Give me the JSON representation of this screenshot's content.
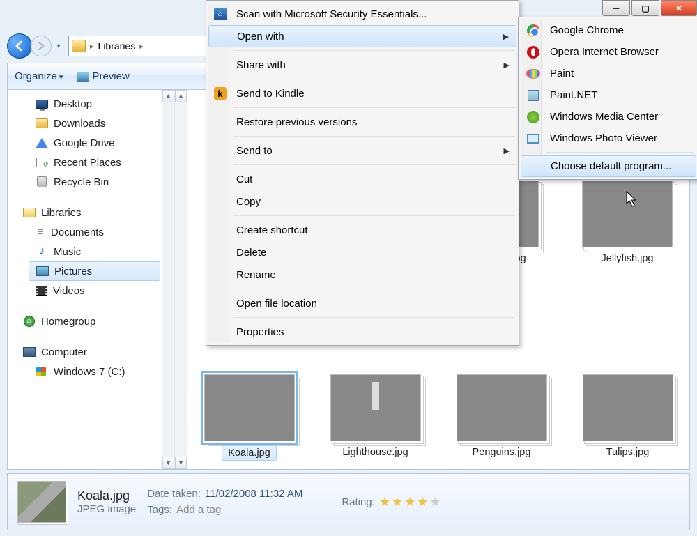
{
  "window": {
    "minimize_symbol": "─",
    "maximize_symbol": "▢",
    "close_symbol": "✕"
  },
  "address_bar": {
    "segments": [
      "Libraries"
    ]
  },
  "toolbar": {
    "organize": "Organize",
    "preview": "Preview"
  },
  "sidebar": {
    "favorites": [
      {
        "icon": "monitor",
        "label": "Desktop"
      },
      {
        "icon": "folder",
        "label": "Downloads"
      },
      {
        "icon": "gdrive",
        "label": "Google Drive"
      },
      {
        "icon": "recent",
        "label": "Recent Places"
      },
      {
        "icon": "recycle",
        "label": "Recycle Bin"
      }
    ],
    "libraries_label": "Libraries",
    "libraries": [
      {
        "icon": "doc",
        "label": "Documents"
      },
      {
        "icon": "music",
        "label": "Music"
      },
      {
        "icon": "pics",
        "label": "Pictures",
        "selected": true
      },
      {
        "icon": "videos",
        "label": "Videos"
      }
    ],
    "homegroup_label": "Homegroup",
    "computer_label": "Computer",
    "drives": [
      {
        "icon": "drive",
        "label": "Windows 7 (C:)"
      }
    ]
  },
  "files_row1_partial_label": ".jpg",
  "files_row1_jellyfish": "Jellyfish.jpg",
  "files": [
    {
      "name": "Koala.jpg",
      "cls": "img-koala",
      "selected": true
    },
    {
      "name": "Lighthouse.jpg",
      "cls": "img-lh"
    },
    {
      "name": "Penguins.jpg",
      "cls": "img-peng"
    },
    {
      "name": "Tulips.jpg",
      "cls": "img-tulip"
    }
  ],
  "details": {
    "filename": "Koala.jpg",
    "filetype": "JPEG image",
    "date_label": "Date taken:",
    "date_value": "11/02/2008 11:32 AM",
    "tags_label": "Tags:",
    "tags_value": "Add a tag",
    "rating_label": "Rating:",
    "rating_value": 4
  },
  "context_menu": {
    "items": [
      {
        "type": "item",
        "label": "Scan with Microsoft Security Essentials...",
        "icon": "mse"
      },
      {
        "type": "item",
        "label": "Open with",
        "submenu": true,
        "highlight": true
      },
      {
        "type": "sep"
      },
      {
        "type": "item",
        "label": "Share with",
        "submenu": true
      },
      {
        "type": "sep"
      },
      {
        "type": "item",
        "label": "Send to Kindle",
        "icon": "kindle"
      },
      {
        "type": "sep"
      },
      {
        "type": "item",
        "label": "Restore previous versions"
      },
      {
        "type": "sep"
      },
      {
        "type": "item",
        "label": "Send to",
        "submenu": true
      },
      {
        "type": "sep"
      },
      {
        "type": "item",
        "label": "Cut"
      },
      {
        "type": "item",
        "label": "Copy"
      },
      {
        "type": "sep"
      },
      {
        "type": "item",
        "label": "Create shortcut"
      },
      {
        "type": "item",
        "label": "Delete"
      },
      {
        "type": "item",
        "label": "Rename"
      },
      {
        "type": "sep"
      },
      {
        "type": "item",
        "label": "Open file location"
      },
      {
        "type": "sep"
      },
      {
        "type": "item",
        "label": "Properties"
      }
    ]
  },
  "submenu": {
    "items": [
      {
        "label": "Google Chrome",
        "icon": "chrome"
      },
      {
        "label": "Opera Internet Browser",
        "icon": "opera"
      },
      {
        "label": "Paint",
        "icon": "paint"
      },
      {
        "label": "Paint.NET",
        "icon": "paintnet"
      },
      {
        "label": "Windows Media Center",
        "icon": "wmc"
      },
      {
        "label": "Windows Photo Viewer",
        "icon": "wpv"
      }
    ],
    "choose_default": "Choose default program..."
  }
}
